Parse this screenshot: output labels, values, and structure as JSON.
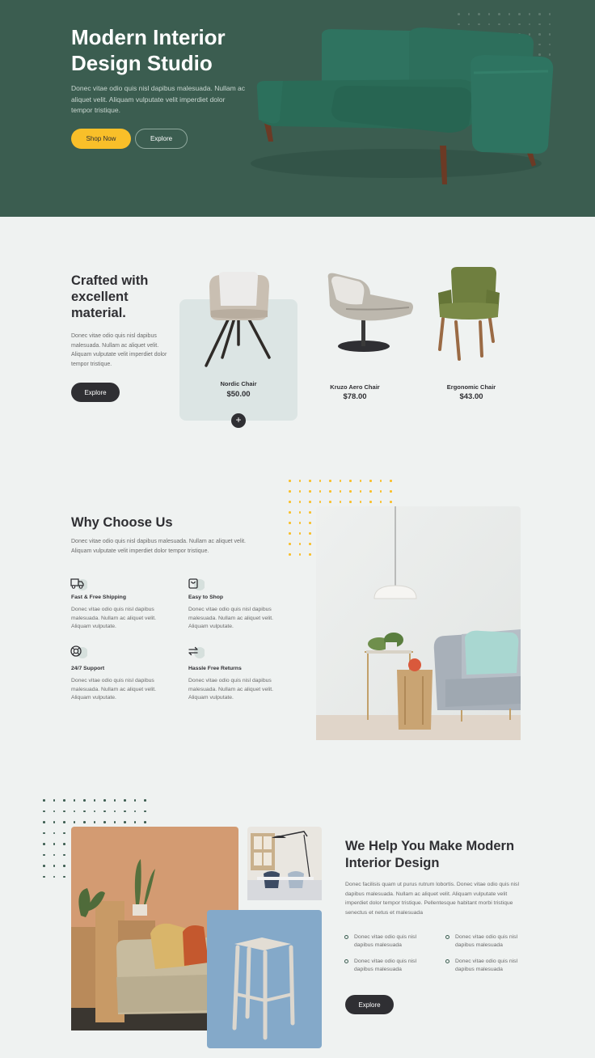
{
  "hero": {
    "title": "Modern Interior Design Studio",
    "description": "Donec vitae odio quis nisl dapibus malesuada. Nullam ac aliquet velit. Aliquam vulputate velit imperdiet dolor tempor tristique.",
    "shop_button": "Shop Now",
    "explore_button": "Explore"
  },
  "products": {
    "title": "Crafted with excellent material.",
    "description": "Donec vitae odio quis nisl dapibus malesuada. Nullam ac aliquet velit. Aliquam vulputate velit imperdiet dolor tempor tristique.",
    "explore_button": "Explore",
    "items": [
      {
        "name": "Nordic Chair",
        "price": "$50.00"
      },
      {
        "name": "Kruzo Aero Chair",
        "price": "$78.00"
      },
      {
        "name": "Ergonomic Chair",
        "price": "$43.00"
      }
    ],
    "add_icon": "plus-icon"
  },
  "why": {
    "title": "Why Choose Us",
    "description": "Donec vitae odio quis nisl dapibus malesuada. Nullam ac aliquet velit. Aliquam vulputate velit imperdiet dolor tempor tristique.",
    "features": [
      {
        "icon": "truck-icon",
        "title": "Fast & Free Shipping",
        "text": "Donec vitae odio quis nisl dapibus malesuada. Nullam ac aliquet velit. Aliquam vulputate."
      },
      {
        "icon": "bag-icon",
        "title": "Easy to Shop",
        "text": "Donec vitae odio quis nisl dapibus malesuada. Nullam ac aliquet velit. Aliquam vulputate."
      },
      {
        "icon": "support-icon",
        "title": "24/7 Support",
        "text": "Donec vitae odio quis nisl dapibus malesuada. Nullam ac aliquet velit. Aliquam vulputate."
      },
      {
        "icon": "returns-icon",
        "title": "Hassle Free Returns",
        "text": "Donec vitae odio quis nisl dapibus malesuada. Nullam ac aliquet velit. Aliquam vulputate."
      }
    ]
  },
  "help": {
    "title": "We Help You Make Modern Interior Design",
    "description": "Donec facilisis quam ut purus rutrum lobortis. Donec vitae odio quis nisl dapibus malesuada. Nullam ac aliquet velit. Aliquam vulputate velit imperdiet dolor tempor tristique. Pellentesque habitant morbi tristique senectus et netus et malesuada",
    "bullets": [
      "Donec vitae odio quis nisl dapibus malesuada",
      "Donec vitae odio quis nisl dapibus malesuada",
      "Donec vitae odio quis nisl dapibus malesuada",
      "Donec vitae odio quis nisl dapibus malesuada"
    ],
    "explore_button": "Explore"
  },
  "colors": {
    "brand_green": "#3b5d50",
    "accent_yellow": "#f9bf29",
    "dark": "#2f2f33",
    "background": "#eff2f1"
  }
}
